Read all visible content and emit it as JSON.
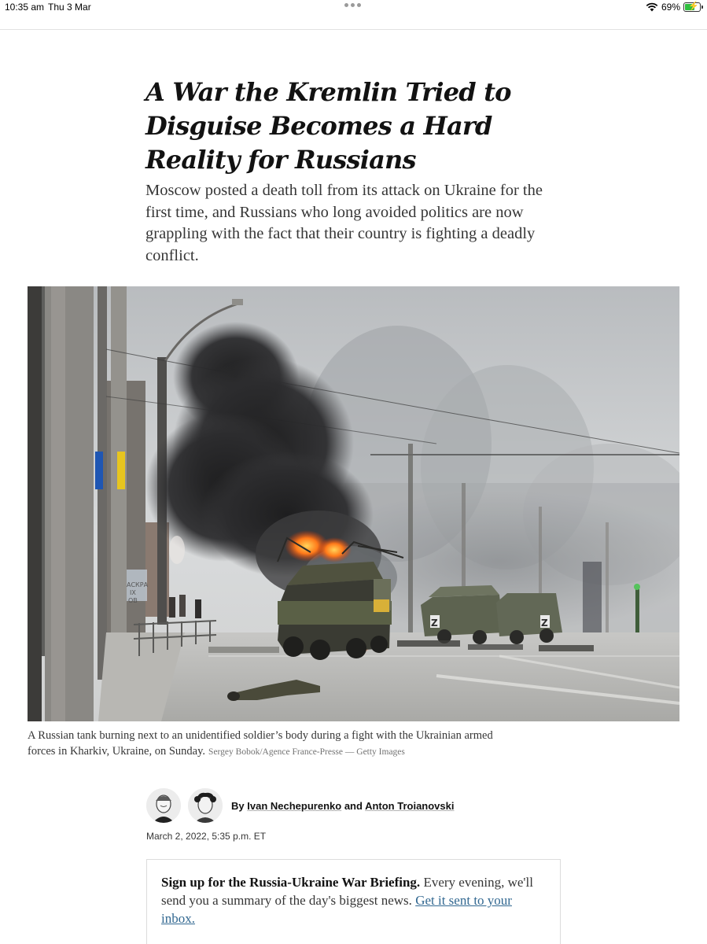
{
  "status_bar": {
    "time": "10:35 am",
    "date": "Thu 3 Mar",
    "battery_percent": "69%",
    "battery_level": 0.69,
    "wifi_icon": "wifi-icon",
    "battery_icon": "battery-charging-icon"
  },
  "article": {
    "headline": "A War the Kremlin Tried to Disguise Becomes a Hard Reality for Russians",
    "summary": "Moscow posted a death toll from its attack on Ukraine for the first time, and Russians who long avoided politics are now grappling with the fact that their country is fighting a deadly conflict.",
    "photo": {
      "caption": "A Russian tank burning next to an unidentified soldier’s body during a fight with the Ukrainian armed forces in Kharkiv, Ukraine, on Sunday.",
      "credit": "Sergey Bobok/Agence France-Presse — Getty Images",
      "sign_text_1": "АСКРА",
      "sign_text_2": "IX",
      "sign_text_3": "ОВ",
      "vehicle_marking": "Z"
    },
    "byline": {
      "prefix": "By",
      "author_1": "Ivan Nechepurenko",
      "conjunction": "and",
      "author_2": "Anton Troianovski"
    },
    "timestamp": "March 2, 2022, 5:35 p.m. ET"
  },
  "newsletter": {
    "lead": "Sign up for the Russia-Ukraine War Briefing.",
    "body": "Every evening, we'll send you a summary of the day's biggest news.",
    "link_text": "Get it sent to your inbox."
  },
  "colors": {
    "link": "#326891",
    "text": "#121212",
    "secondary_text": "#363636",
    "caption_credit": "#727272",
    "battery_fill": "#2fbf3f"
  }
}
